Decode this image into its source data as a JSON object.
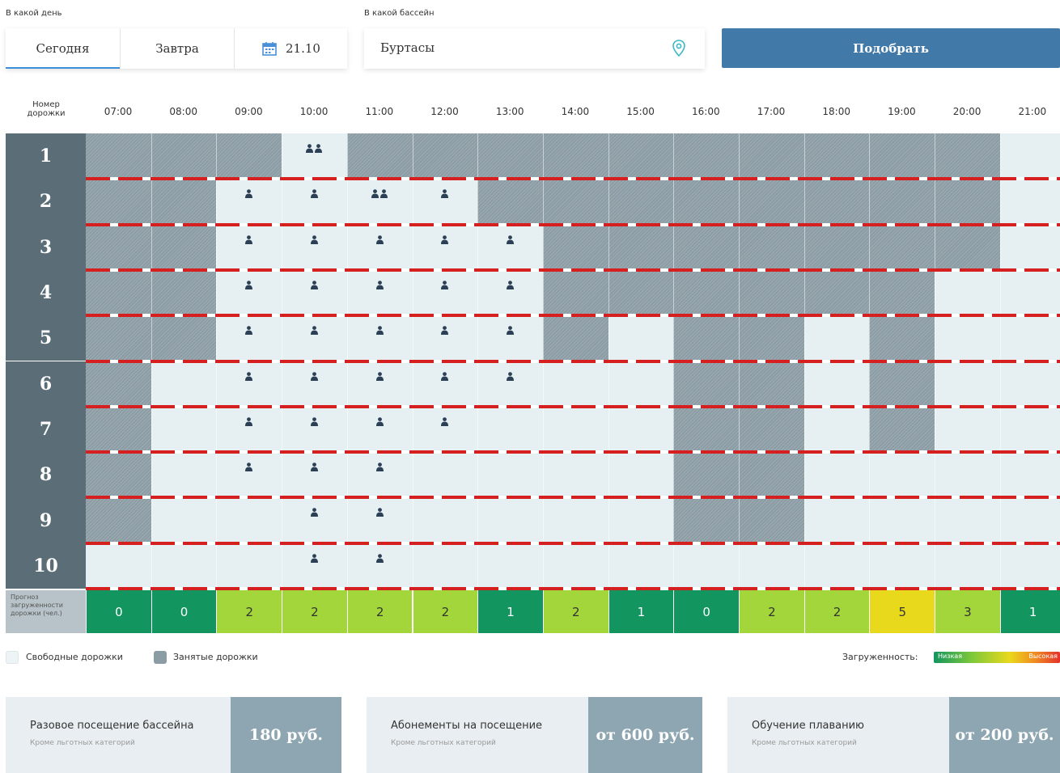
{
  "filters": {
    "day_label": "В какой день",
    "pool_label": "В какой бассейн",
    "tabs": [
      {
        "label": "Сегодня",
        "active": true
      },
      {
        "label": "Завтра",
        "active": false
      }
    ],
    "date": "21.10",
    "pool_value": "Буртасы",
    "submit_label": "Подобрать"
  },
  "schedule": {
    "lane_header": "Номер дорожки",
    "times": [
      "07:00",
      "08:00",
      "09:00",
      "10:00",
      "11:00",
      "12:00",
      "13:00",
      "14:00",
      "15:00",
      "16:00",
      "17:00",
      "18:00",
      "19:00",
      "20:00",
      "21:00"
    ],
    "lanes": [
      "1",
      "2",
      "3",
      "4",
      "5",
      "6",
      "7",
      "8",
      "9",
      "10"
    ],
    "busy": [
      [
        1,
        1,
        1,
        0,
        1,
        1,
        1,
        1,
        1,
        1,
        1,
        1,
        1,
        1,
        0
      ],
      [
        1,
        1,
        0,
        0,
        0,
        0,
        1,
        1,
        1,
        1,
        1,
        1,
        1,
        1,
        0
      ],
      [
        1,
        1,
        0,
        0,
        0,
        0,
        0,
        1,
        1,
        1,
        1,
        1,
        1,
        1,
        0
      ],
      [
        1,
        1,
        0,
        0,
        0,
        0,
        0,
        1,
        1,
        1,
        1,
        1,
        1,
        0,
        0
      ],
      [
        1,
        1,
        0,
        0,
        0,
        0,
        0,
        1,
        0,
        1,
        1,
        0,
        1,
        0,
        0
      ],
      [
        1,
        0,
        0,
        0,
        0,
        0,
        0,
        0,
        0,
        1,
        1,
        0,
        1,
        0,
        0
      ],
      [
        1,
        0,
        0,
        0,
        0,
        0,
        0,
        0,
        0,
        1,
        1,
        0,
        1,
        0,
        0
      ],
      [
        1,
        0,
        0,
        0,
        0,
        0,
        0,
        0,
        0,
        1,
        1,
        0,
        0,
        0,
        0
      ],
      [
        1,
        0,
        0,
        0,
        0,
        0,
        0,
        0,
        0,
        1,
        1,
        0,
        0,
        0,
        0
      ],
      [
        0,
        0,
        0,
        0,
        0,
        0,
        0,
        0,
        0,
        0,
        0,
        0,
        0,
        0,
        0
      ]
    ],
    "people": [
      [
        0,
        0,
        0,
        2,
        0,
        0,
        0,
        0,
        0,
        0,
        0,
        0,
        0,
        0,
        0
      ],
      [
        0,
        0,
        1,
        1,
        2,
        1,
        0,
        0,
        0,
        0,
        0,
        0,
        0,
        0,
        0
      ],
      [
        0,
        0,
        1,
        1,
        1,
        1,
        1,
        0,
        0,
        0,
        0,
        0,
        0,
        0,
        0
      ],
      [
        0,
        0,
        1,
        1,
        1,
        1,
        1,
        0,
        0,
        0,
        0,
        0,
        0,
        0,
        0
      ],
      [
        0,
        0,
        1,
        1,
        1,
        1,
        1,
        0,
        0,
        0,
        0,
        0,
        0,
        0,
        0
      ],
      [
        0,
        0,
        1,
        1,
        1,
        1,
        1,
        0,
        0,
        0,
        0,
        0,
        0,
        0,
        0
      ],
      [
        0,
        0,
        1,
        1,
        1,
        1,
        0,
        0,
        0,
        0,
        0,
        0,
        0,
        0,
        0
      ],
      [
        0,
        0,
        1,
        1,
        1,
        0,
        0,
        0,
        0,
        0,
        0,
        0,
        0,
        0,
        0
      ],
      [
        0,
        0,
        0,
        1,
        1,
        0,
        0,
        0,
        0,
        0,
        0,
        0,
        0,
        0,
        0
      ],
      [
        0,
        0,
        0,
        1,
        1,
        0,
        0,
        0,
        0,
        0,
        0,
        0,
        0,
        0,
        0
      ]
    ],
    "forecast_label": "Прогноз загруженности дорожки (чел.)",
    "forecast": [
      "0",
      "0",
      "2",
      "2",
      "2",
      "2",
      "1",
      "2",
      "1",
      "0",
      "2",
      "2",
      "5",
      "3",
      "1"
    ],
    "forecast_colors": [
      "#13955f",
      "#13955f",
      "#a3d63a",
      "#a3d63a",
      "#a3d63a",
      "#a3d63a",
      "#13955f",
      "#a3d63a",
      "#13955f",
      "#13955f",
      "#a3d63a",
      "#a3d63a",
      "#e9d91c",
      "#a3d63a",
      "#13955f"
    ]
  },
  "legend": {
    "free": "Свободные дорожки",
    "busy": "Занятые дорожки",
    "load_label": "Загруженность:",
    "low": "Низкая",
    "high": "Высокая"
  },
  "prices": [
    {
      "title": "Разовое посещение бассейна",
      "subtitle": "Кроме льготных категорий",
      "price": "180 руб."
    },
    {
      "title": "Абонементы на посещение",
      "subtitle": "Кроме льготных категорий",
      "price": "от 600 руб."
    },
    {
      "title": "Обучение плаванию",
      "subtitle": "Кроме льготных категорий",
      "price": "от 200 руб."
    }
  ],
  "icons": {
    "calendar": "calendar-icon",
    "location": "location-pin-icon",
    "person": "person-icon"
  },
  "colors": {
    "primary": "#4179a8",
    "busy": "#8c9ca4",
    "free": "#e6f0f2",
    "lane": "#5b6e78",
    "rope": "#d62020"
  }
}
